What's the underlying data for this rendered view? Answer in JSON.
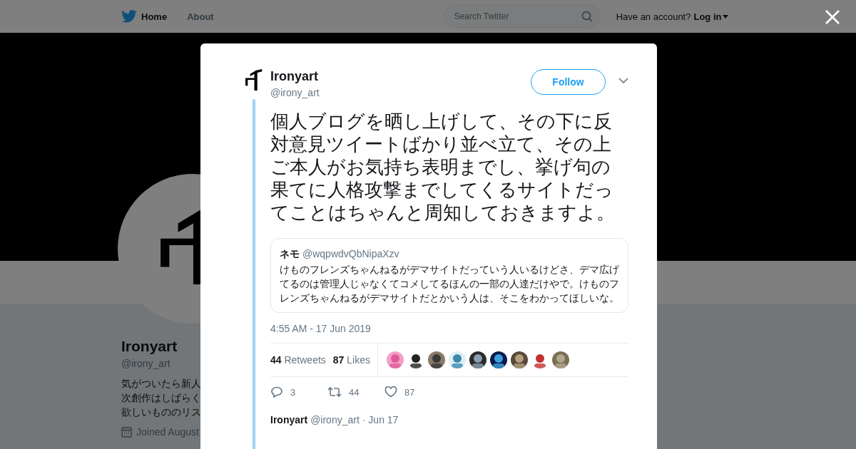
{
  "nav": {
    "items": [
      {
        "label": "Home",
        "selected": true
      },
      {
        "label": "About",
        "selected": false
      }
    ],
    "search": {
      "placeholder": "Search Twitter"
    },
    "account_prompt": "Have an account?",
    "login": "Log in"
  },
  "profile": {
    "name": "Ironyart",
    "handle": "@irony_art",
    "bio_lines": [
      "気がついたら新人",
      "次創作はしばらく",
      "欲しいもののリス"
    ],
    "joined": "Joined August"
  },
  "tweet": {
    "name": "Ironyart",
    "handle": "@irony_art",
    "follow": "Follow",
    "text": "個人ブログを晒し上げして、その下に反対意見ツイートばかり並べ立て、その上ご本人がお気持ち表明までし、挙げ句の果てに人格攻撃までしてくるサイトだってことはちゃんと周知しておきますよ。",
    "quote": {
      "name": "ネモ",
      "handle": "@wqpwdvQbNipaXzv",
      "text": "けものフレンズちゃんねるがデマサイトだっていう人いるけどさ、デマ広げてるのは管理人じゃなくてコメしてるほんの一部の人達だけやで。けものフレンズちゃんねるがデマサイトだとかいう人は、そこをわかってほしいな。"
    },
    "timestamp": "4:55 AM - 17 Jun 2019",
    "stats": [
      {
        "count": "44",
        "label": "Retweets"
      },
      {
        "count": "87",
        "label": "Likes"
      }
    ],
    "actions": [
      {
        "kind": "reply",
        "count": "3"
      },
      {
        "kind": "retweet",
        "count": "44"
      },
      {
        "kind": "like",
        "count": "87"
      }
    ]
  },
  "next_tweet": {
    "name": "Ironyart",
    "handle": "@irony_art",
    "date": "· Jun 17"
  }
}
